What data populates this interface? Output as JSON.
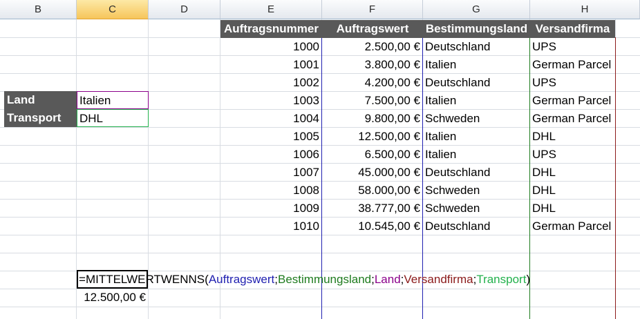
{
  "columns": [
    "B",
    "C",
    "D",
    "E",
    "F",
    "G",
    "H"
  ],
  "table": {
    "headers": [
      "Auftragsnummer",
      "Auftragswert",
      "Bestimmungsland",
      "Versandfirma"
    ],
    "rows": [
      [
        "1000",
        "2.500,00 €",
        "Deutschland",
        "UPS"
      ],
      [
        "1001",
        "3.800,00 €",
        "Italien",
        "German Parcel"
      ],
      [
        "1002",
        "4.200,00 €",
        "Deutschland",
        "UPS"
      ],
      [
        "1003",
        "7.500,00 €",
        "Italien",
        "German Parcel"
      ],
      [
        "1004",
        "9.800,00 €",
        "Schweden",
        "German Parcel"
      ],
      [
        "1005",
        "12.500,00 €",
        "Italien",
        "DHL"
      ],
      [
        "1006",
        "6.500,00 €",
        "Italien",
        "UPS"
      ],
      [
        "1007",
        "45.000,00 €",
        "Deutschland",
        "DHL"
      ],
      [
        "1008",
        "58.000,00 €",
        "Schweden",
        "DHL"
      ],
      [
        "1009",
        "38.777,00 €",
        "Schweden",
        "DHL"
      ],
      [
        "1010",
        "10.545,00 €",
        "Deutschland",
        "German Parcel"
      ]
    ]
  },
  "criteria": {
    "land_label": "Land",
    "land_value": "Italien",
    "transport_label": "Transport",
    "transport_value": "DHL"
  },
  "formula": {
    "eq": "=",
    "func": "MITTELWERTWENNS(",
    "arg1": "Auftragswert",
    "sep1": ";",
    "arg2": "Bestimmungsland",
    "sep2": ";",
    "arg3": "Land",
    "sep3": ";",
    "arg4": "Versandfirma",
    "sep4": ";",
    "arg5": "Transport",
    "close": ")"
  },
  "result": "12.500,00 €",
  "colors": {
    "auftragswert": "#1f1fb0",
    "bestimmungsland": "#1e7b1e",
    "land": "#8b008b",
    "versandfirma": "#8b1a1a",
    "transport": "#22b14c"
  }
}
